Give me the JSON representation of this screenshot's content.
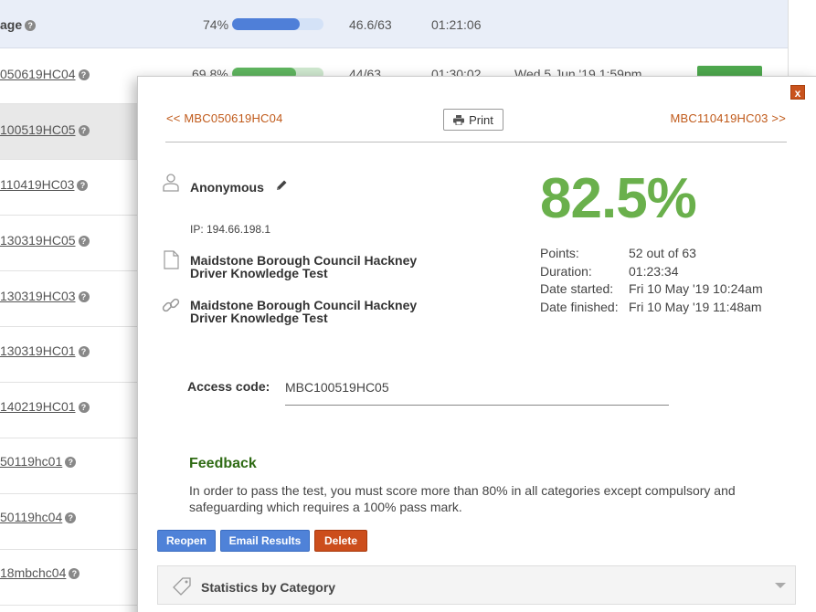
{
  "background_table": {
    "header_row": {
      "label": "age",
      "percent": "74%",
      "progress": 0.74,
      "points": "46.6/63",
      "time": "01:21:06"
    },
    "rows": [
      {
        "code": "050619HC04",
        "percent": "69.8%",
        "progress": 0.698,
        "points": "44/63",
        "time": "01:30:02",
        "date": "Wed 5 Jun '19 1:59pm"
      },
      {
        "code": "100519HC05"
      },
      {
        "code": "110419HC03"
      },
      {
        "code": "130319HC05"
      },
      {
        "code": "130319HC03"
      },
      {
        "code": "130319HC01"
      },
      {
        "code": "140219HC01"
      },
      {
        "code": "50119hc01"
      },
      {
        "code": "50119hc04"
      },
      {
        "code": "18mbchc04"
      }
    ],
    "help_glyph": "?"
  },
  "modal": {
    "close_label": "x",
    "nav": {
      "prev": "<<  MBC050619HC04",
      "next": "MBC110419HC03  >>"
    },
    "print_label": "Print",
    "user": {
      "name": "Anonymous",
      "ip": "IP: 194.66.198.1"
    },
    "test_name_1_line1": "Maidstone Borough Council Hackney",
    "test_name_1_line2": "Driver Knowledge Test",
    "test_name_2_line1": "Maidstone Borough Council Hackney",
    "test_name_2_line2": "Driver Knowledge Test",
    "score": "82.5%",
    "score_color": "#6ab04c",
    "stats": [
      {
        "label": "Points:",
        "value": "52 out of 63"
      },
      {
        "label": "Duration:",
        "value": "01:23:34"
      },
      {
        "label": "Date started:",
        "value": "Fri 10 May '19 10:24am"
      },
      {
        "label": "Date finished:",
        "value": "Fri 10 May '19 11:48am"
      }
    ],
    "access": {
      "label": "Access code:",
      "value": "MBC100519HC05"
    },
    "feedback": {
      "title": "Feedback",
      "text": "In order to pass the test, you must score more than 80% in all categories except compulsory and safeguarding which requires a 100% pass mark."
    },
    "buttons": {
      "reopen": "Reopen",
      "email": "Email Results",
      "delete": "Delete"
    },
    "stats_panel_title": "Statistics by Category"
  }
}
